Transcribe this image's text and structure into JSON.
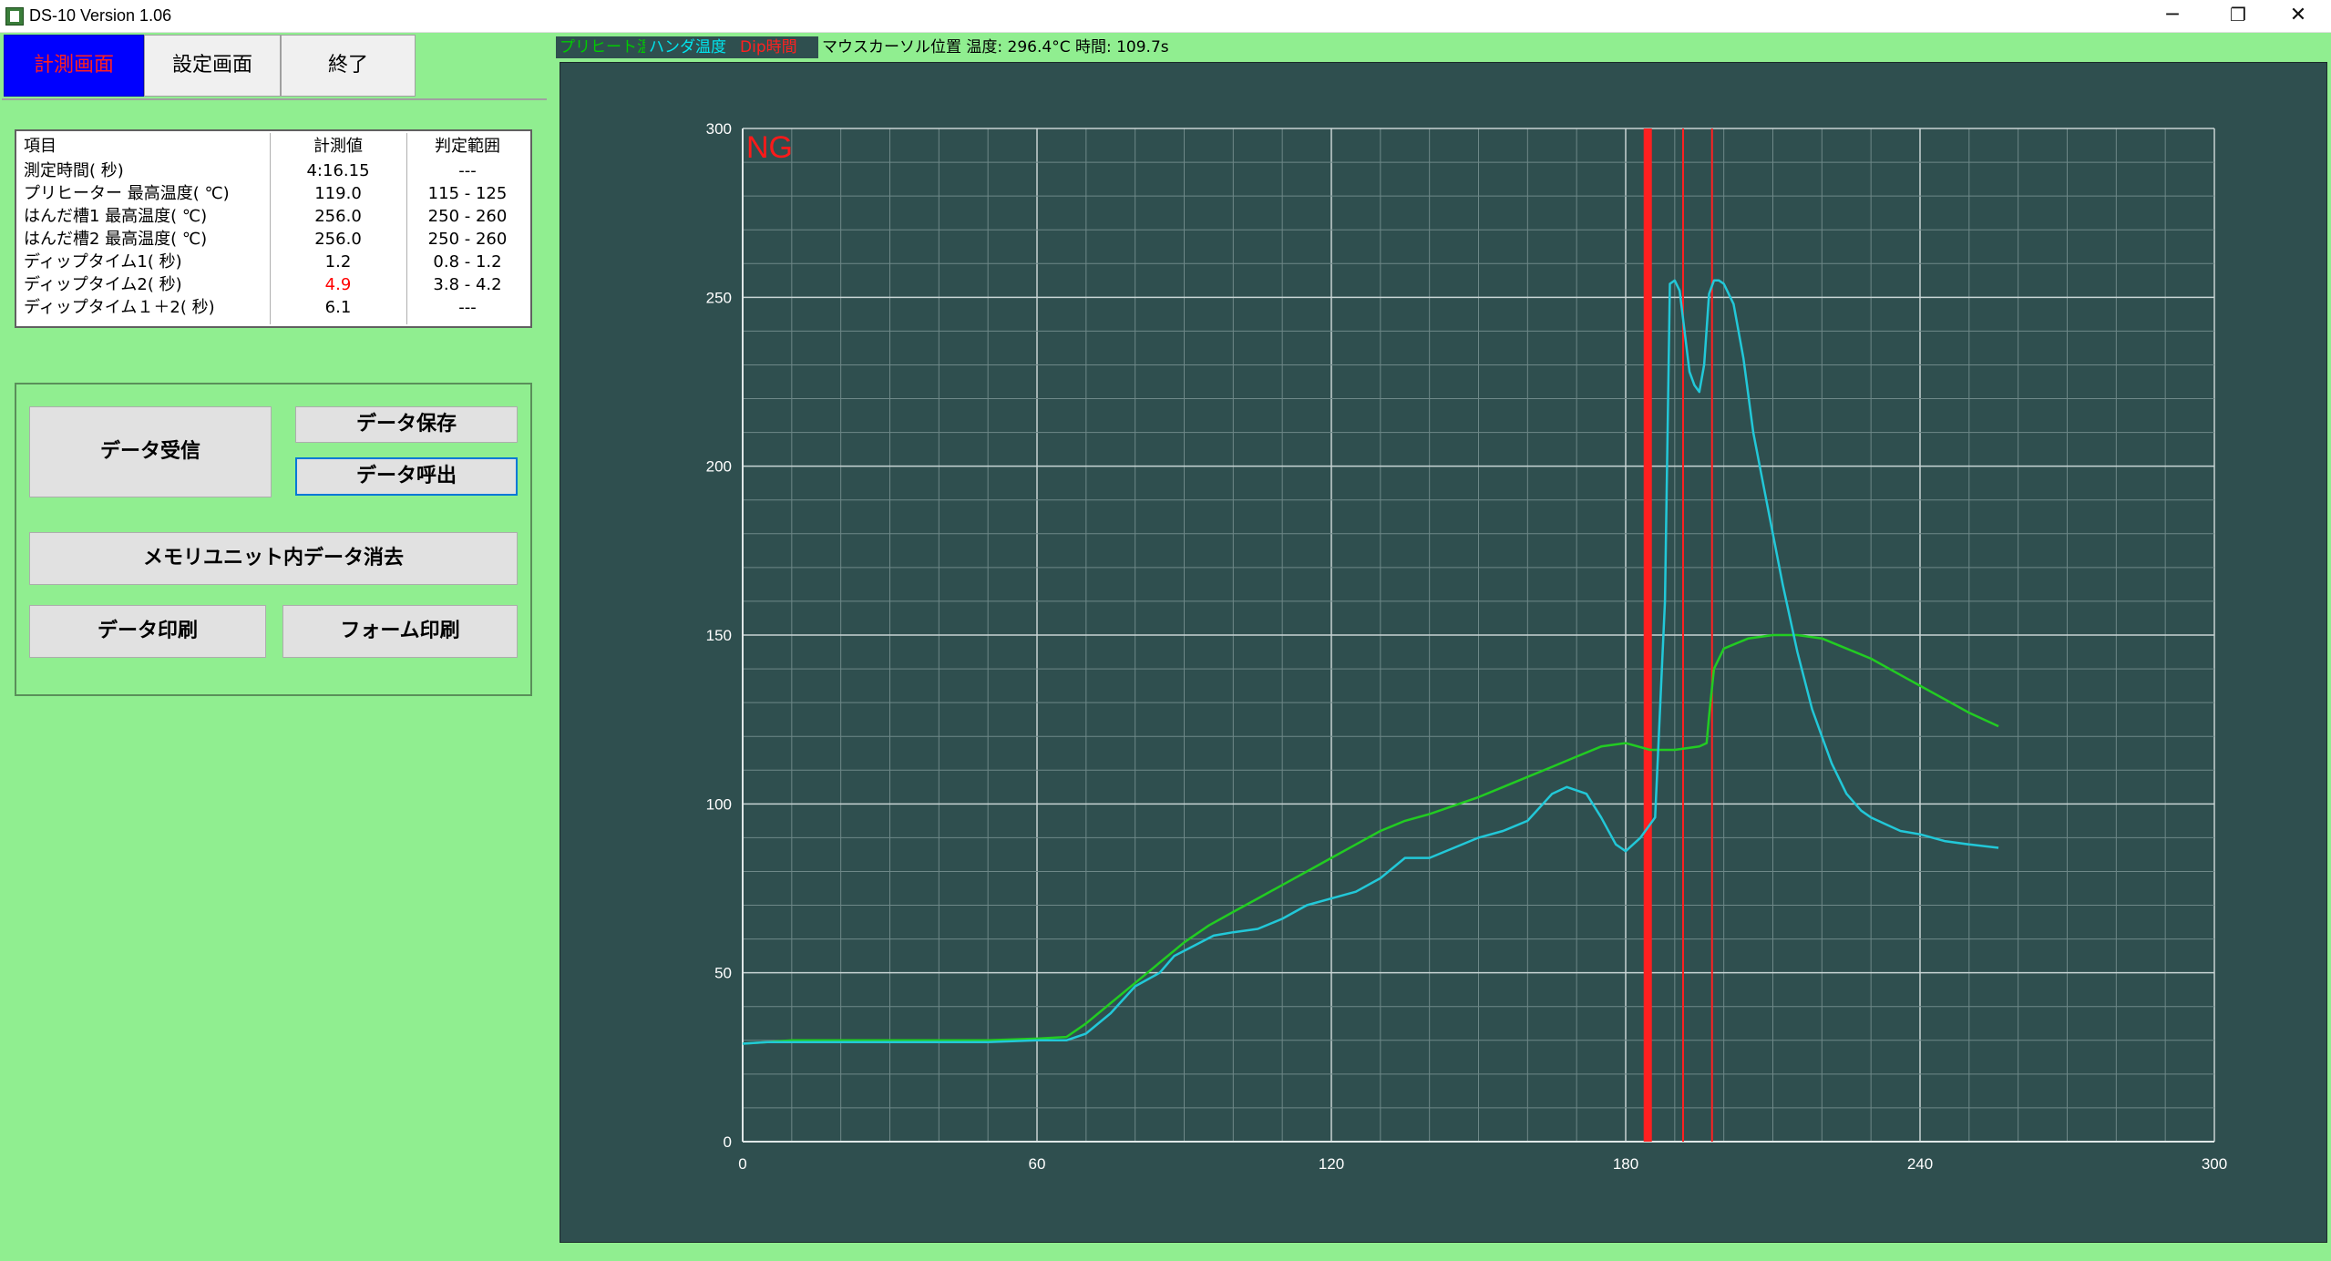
{
  "window": {
    "title": "DS-10 Version 1.06",
    "controls": {
      "minimize": "─",
      "maximize": "❐",
      "close": "✕"
    }
  },
  "tabs": [
    {
      "label": "計測画面",
      "active": true
    },
    {
      "label": "設定画面",
      "active": false
    },
    {
      "label": "終了",
      "active": false
    }
  ],
  "results": {
    "headers": [
      "項目",
      "計測値",
      "判定範囲"
    ],
    "rows": [
      {
        "item": "測定時間( 秒)",
        "value": "4:16.15",
        "range": "---"
      },
      {
        "item": "プリヒーター 最高温度( ℃)",
        "value": "119.0",
        "range": "115 - 125"
      },
      {
        "item": "はんだ槽1 最高温度( ℃)",
        "value": "256.0",
        "range": "250 - 260"
      },
      {
        "item": "はんだ槽2 最高温度( ℃)",
        "value": "256.0",
        "range": "250 - 260"
      },
      {
        "item": "ディップタイム1( 秒)",
        "value": "1.2",
        "range": "0.8 - 1.2"
      },
      {
        "item": "ディップタイム2( 秒)",
        "value": "4.9",
        "range": "3.8 - 4.2",
        "ng": true
      },
      {
        "item": "ディップタイム１＋2( 秒)",
        "value": "6.1",
        "range": "---"
      }
    ]
  },
  "buttons": {
    "receive": "データ受信",
    "save": "データ保存",
    "load": "データ呼出",
    "erase": "メモリユニット内データ消去",
    "print_data": "データ印刷",
    "print_form": "フォーム印刷"
  },
  "legend": {
    "preheat": "プリヒート温度",
    "solder": "ハンダ温度",
    "dip": "Dip時間"
  },
  "cursor_readout": "マウスカーソル位置 温度: 296.4°C  時間: 109.7s",
  "colors": {
    "background": "#90ee90",
    "chart_bg": "#2f4f4f",
    "preheat_line": "#22cc22",
    "solder_line": "#22c8d8",
    "dip_marker": "#ff2020",
    "active_tab_bg": "#0000ff",
    "active_tab_text": "#ff2020"
  },
  "chart_data": {
    "type": "line",
    "judgement": "NG",
    "xlim": [
      0,
      300
    ],
    "ylim": [
      0,
      300
    ],
    "xticks": [
      0,
      60,
      120,
      180,
      240,
      300
    ],
    "yticks": [
      0,
      50,
      100,
      150,
      200,
      250,
      300
    ],
    "grid": true,
    "legend_position": "top-left",
    "dip_markers": [
      {
        "x": 184.5,
        "thick": true
      },
      {
        "x": 191.7,
        "thick": false
      },
      {
        "x": 197.6,
        "thick": false
      }
    ],
    "series": [
      {
        "name": "プリヒート温度",
        "x": [
          0,
          5,
          10,
          20,
          30,
          40,
          50,
          60,
          66,
          70,
          75,
          80,
          85,
          90,
          95,
          100,
          105,
          110,
          115,
          120,
          125,
          130,
          135,
          140,
          145,
          150,
          155,
          160,
          165,
          170,
          175,
          180,
          185,
          190,
          195,
          196.5,
          197,
          198,
          200,
          205,
          210,
          215,
          220,
          225,
          230,
          235,
          240,
          245,
          250,
          256
        ],
        "y": [
          29,
          29.5,
          30,
          30,
          30,
          30,
          30,
          30.5,
          31,
          35,
          41,
          47,
          53,
          59,
          64,
          68,
          72,
          76,
          80,
          84,
          88,
          92,
          95,
          97,
          99.5,
          102,
          105,
          108,
          111,
          114,
          117,
          118,
          116,
          116,
          117,
          118,
          126,
          140,
          146,
          149,
          150,
          150,
          149,
          146,
          143,
          139,
          135,
          131,
          127,
          123
        ]
      },
      {
        "name": "ハンダ温度",
        "x": [
          0,
          5,
          10,
          20,
          30,
          40,
          50,
          60,
          66,
          70,
          75,
          80,
          85,
          88,
          92,
          96,
          100,
          105,
          110,
          115,
          120,
          125,
          130,
          135,
          140,
          145,
          150,
          155,
          160,
          165,
          168,
          172,
          175,
          178,
          180,
          183,
          186,
          188,
          189,
          190,
          191,
          192,
          193,
          194,
          195,
          196,
          197,
          198,
          199,
          200,
          202,
          204,
          206,
          208,
          210,
          212,
          215,
          218,
          220,
          222,
          225,
          228,
          230,
          233,
          236,
          240,
          245,
          250,
          256
        ],
        "y": [
          29,
          29.5,
          29.5,
          29.5,
          29.5,
          29.5,
          29.5,
          30,
          30,
          32,
          38,
          46,
          50,
          55,
          58,
          61,
          62,
          63,
          66,
          70,
          72,
          74,
          78,
          84,
          84,
          87,
          90,
          92,
          95,
          103,
          105,
          103,
          96,
          88,
          86,
          90,
          96,
          160,
          254,
          255,
          252,
          240,
          228,
          224,
          222,
          230,
          251,
          255,
          255,
          254,
          248,
          232,
          210,
          195,
          180,
          165,
          145,
          128,
          120,
          112,
          103,
          98,
          96,
          94,
          92,
          91,
          89,
          88,
          87
        ]
      }
    ]
  }
}
